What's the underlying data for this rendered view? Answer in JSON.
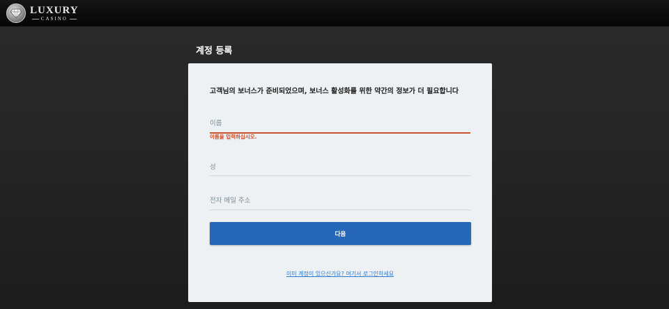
{
  "header": {
    "logo_main": "LUXURY",
    "logo_sub": "CASINO",
    "logo_icon": "diamond-badge-icon"
  },
  "page": {
    "heading": "계정 등록"
  },
  "form": {
    "title": "고객님의 보너스가 준비되었으며, 보너스 활성화를 위한 약간의 정보가 더 필요합니다",
    "first_name_placeholder": "이름",
    "first_name_value": "",
    "first_name_error": "이름을 입력하십시오.",
    "last_name_placeholder": "성",
    "last_name_value": "",
    "email_placeholder": "전자 메일 주소",
    "email_value": "",
    "next_label": "다음",
    "login_link": "이미 계정이 있으신가요? 여기서 로그인하세요"
  },
  "colors": {
    "accent": "#2767b9",
    "error": "#d24a25",
    "link": "#2b7ad0",
    "card_bg": "#eef1f3"
  }
}
